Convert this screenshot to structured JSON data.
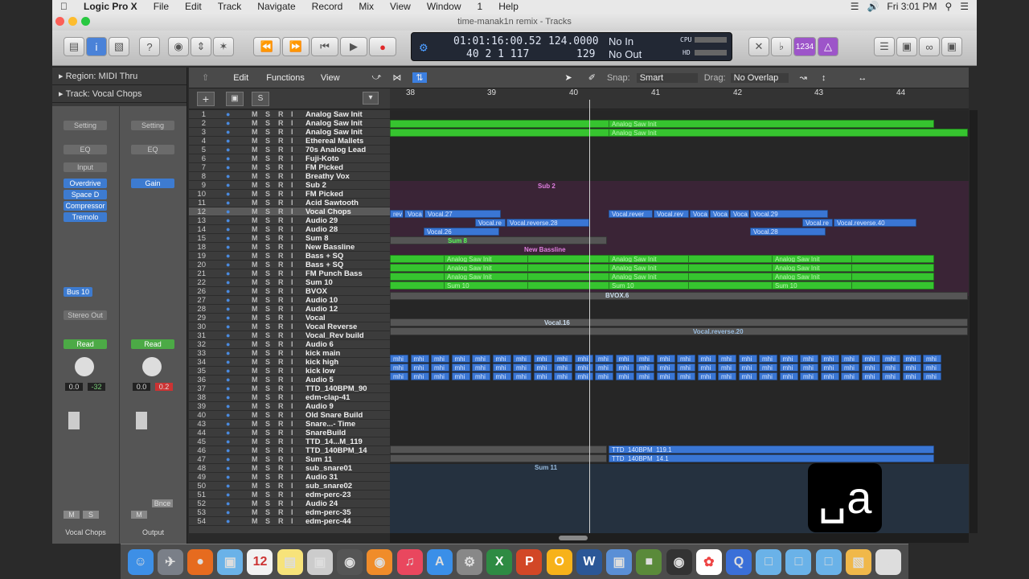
{
  "menubar": {
    "app": "Logic Pro X",
    "items": [
      "File",
      "Edit",
      "Track",
      "Navigate",
      "Record",
      "Mix",
      "View",
      "Window",
      "1",
      "Help"
    ],
    "clock": "Fri 3:01 PM"
  },
  "window": {
    "title": "time-manak1n remix - Tracks"
  },
  "toolbar": {
    "lcd": {
      "position": "01:01:16:00.52",
      "bars": "40  2  1  117",
      "tempo": "124.0000",
      "tempo_sub": "129",
      "midi_in": "No In",
      "midi_out": "No Out",
      "cpu": "CPU",
      "hd": "HD"
    },
    "count_label": "1234"
  },
  "inspector": {
    "region": "Region: MIDI Thru",
    "track": "Track: Vocal Chops",
    "strip1": {
      "setting": "Setting",
      "eq": "EQ",
      "input": "Input",
      "plugins": [
        "Overdrive",
        "Space D",
        "Compressor",
        "Tremolo"
      ],
      "bus": "Bus 10",
      "output": "Stereo Out",
      "auto": "Read",
      "vol": "0.0",
      "pan": "-32",
      "mute": "M",
      "solo": "S",
      "name": "Vocal Chops"
    },
    "strip2": {
      "setting": "Setting",
      "eq": "EQ",
      "plugin": "Gain",
      "auto": "Read",
      "vol": "0.0",
      "pan": "0.2",
      "mute": "M",
      "bnce": "Bnce",
      "name": "Output"
    }
  },
  "editbar": {
    "edit": "Edit",
    "functions": "Functions",
    "view": "View",
    "snap_label": "Snap:",
    "snap": "Smart",
    "drag_label": "Drag:",
    "drag": "No Overlap"
  },
  "ruler": [
    "38",
    "39",
    "40",
    "41",
    "42",
    "43",
    "44"
  ],
  "tracks": [
    {
      "n": "1",
      "name": "Analog Saw Init"
    },
    {
      "n": "2",
      "name": "Analog Saw Init"
    },
    {
      "n": "3",
      "name": "Analog Saw Init"
    },
    {
      "n": "4",
      "name": "Ethereal Mallets"
    },
    {
      "n": "5",
      "name": "70s Analog Lead"
    },
    {
      "n": "6",
      "name": "Fuji-Koto"
    },
    {
      "n": "7",
      "name": "FM Picked"
    },
    {
      "n": "8",
      "name": "Breathy Vox"
    },
    {
      "n": "9",
      "name": "Sub 2"
    },
    {
      "n": "10",
      "name": "FM Picked"
    },
    {
      "n": "11",
      "name": "Acid Sawtooth"
    },
    {
      "n": "12",
      "name": "Vocal Chops"
    },
    {
      "n": "13",
      "name": "Audio 29"
    },
    {
      "n": "14",
      "name": "Audio 28"
    },
    {
      "n": "15",
      "name": "Sum 8"
    },
    {
      "n": "18",
      "name": "New Bassline"
    },
    {
      "n": "19",
      "name": "Bass + SQ"
    },
    {
      "n": "20",
      "name": "Bass + SQ"
    },
    {
      "n": "21",
      "name": "FM Punch Bass"
    },
    {
      "n": "22",
      "name": "Sum 10"
    },
    {
      "n": "26",
      "name": "BVOX"
    },
    {
      "n": "27",
      "name": "Audio 10"
    },
    {
      "n": "28",
      "name": "Audio 12"
    },
    {
      "n": "29",
      "name": "Vocal"
    },
    {
      "n": "30",
      "name": "Vocal Reverse"
    },
    {
      "n": "31",
      "name": "Vocal_Rev build"
    },
    {
      "n": "32",
      "name": "Audio 6"
    },
    {
      "n": "33",
      "name": "kick main"
    },
    {
      "n": "34",
      "name": "kick high"
    },
    {
      "n": "35",
      "name": "kick low"
    },
    {
      "n": "36",
      "name": "Audio 5"
    },
    {
      "n": "37",
      "name": "TTD_140BPM_90"
    },
    {
      "n": "38",
      "name": "edm-clap-41"
    },
    {
      "n": "39",
      "name": "Audio 9"
    },
    {
      "n": "40",
      "name": "Old Snare Build"
    },
    {
      "n": "43",
      "name": "Snare...- Time"
    },
    {
      "n": "44",
      "name": "SnareBuild"
    },
    {
      "n": "45",
      "name": "TTD_14...M_119"
    },
    {
      "n": "46",
      "name": "TTD_140BPM_14"
    },
    {
      "n": "47",
      "name": "Sum 11"
    },
    {
      "n": "48",
      "name": "sub_snare01"
    },
    {
      "n": "49",
      "name": "Audio 31"
    },
    {
      "n": "50",
      "name": "sub_snare02"
    },
    {
      "n": "51",
      "name": "edm-perc-23"
    },
    {
      "n": "52",
      "name": "Audio 24"
    },
    {
      "n": "53",
      "name": "edm-perc-35"
    },
    {
      "n": "54",
      "name": "edm-perc-44"
    }
  ],
  "regions": {
    "saw": "Analog Saw Init",
    "sub2": "Sub 2",
    "newbass": "New Bassline",
    "sum8": "Sum 8",
    "sum10": "Sum 10",
    "sum11": "Sum 11",
    "rev": "rev",
    "voca": "Voca",
    "vocal27": "Vocal.27",
    "vocalre": "Vocal.re",
    "vocalrev28": "Vocal.reverse.28",
    "vocalrever": "Vocal.rever",
    "vocalrev": "Vocal.rev",
    "vocal29": "Vocal.29",
    "vocalrev40": "Vocal.reverse.40",
    "vocal26": "Vocal.26",
    "vocal28": "Vocal.28",
    "bvox": "BVOX.6",
    "vocal16": "Vocal.16",
    "vocalrev20": "Vocal.reverse.20",
    "mhi": "mhi",
    "ttd119": "TTD_140BPM_119.1",
    "ttd14": "TTD_140BPM_14.1"
  },
  "logo": "␣a"
}
